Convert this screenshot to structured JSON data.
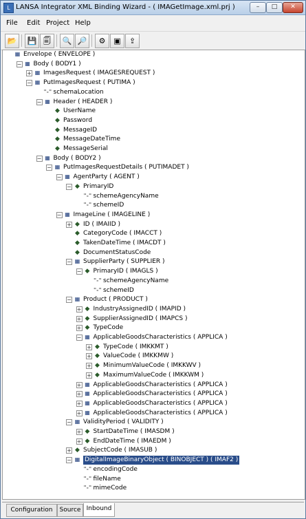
{
  "window": {
    "title": "LANSA Integrator XML Binding Wizard - ( IMAGetImage.xml.prj )"
  },
  "titlebar_buttons": {
    "minimize": "–",
    "maximize": "□",
    "close": "✕"
  },
  "menu": [
    "File",
    "Edit",
    "Project",
    "Help"
  ],
  "toolbar": [
    {
      "name": "open-button",
      "glyph": "📂"
    },
    {
      "name": "save-button",
      "glyph": "💾"
    },
    {
      "name": "save-all-button",
      "glyph": "🗐"
    },
    {
      "name": "find-button",
      "glyph": "🔍"
    },
    {
      "name": "find-next-button",
      "glyph": "🔎"
    },
    {
      "name": "link-button",
      "glyph": "⚙"
    },
    {
      "name": "generate-button",
      "glyph": "▣"
    },
    {
      "name": "export-button",
      "glyph": "⇪"
    }
  ],
  "tree": [
    {
      "lvl": 0,
      "icon": "elem",
      "tog": "",
      "label": "Envelope ( ENVELOPE )"
    },
    {
      "lvl": 1,
      "icon": "elem",
      "tog": "−",
      "label": "Body ( BODY1 )"
    },
    {
      "lvl": 2,
      "icon": "elem",
      "tog": "+",
      "label": "ImagesRequest ( IMAGESREQUEST )"
    },
    {
      "lvl": 2,
      "icon": "elem",
      "tog": "−",
      "label": "PutImagesRequest ( PUTIMA )"
    },
    {
      "lvl": 3,
      "icon": "attr",
      "tog": "",
      "label": "schemaLocation"
    },
    {
      "lvl": 3,
      "icon": "elem",
      "tog": "−",
      "label": "Header ( HEADER )"
    },
    {
      "lvl": 4,
      "icon": "field",
      "tog": "",
      "label": "UserName"
    },
    {
      "lvl": 4,
      "icon": "field",
      "tog": "",
      "label": "Password"
    },
    {
      "lvl": 4,
      "icon": "field",
      "tog": "",
      "label": "MessageID"
    },
    {
      "lvl": 4,
      "icon": "field",
      "tog": "",
      "label": "MessageDateTime"
    },
    {
      "lvl": 4,
      "icon": "field",
      "tog": "",
      "label": "MessageSerial"
    },
    {
      "lvl": 3,
      "icon": "elem",
      "tog": "−",
      "label": "Body ( BODY2 )"
    },
    {
      "lvl": 4,
      "icon": "elem",
      "tog": "−",
      "label": "PutImagesRequestDetails ( PUTIMADET )"
    },
    {
      "lvl": 5,
      "icon": "elem",
      "tog": "−",
      "label": "AgentParty ( AGENT )"
    },
    {
      "lvl": 6,
      "icon": "field",
      "tog": "−",
      "label": "PrimaryID"
    },
    {
      "lvl": 7,
      "icon": "attr",
      "tog": "",
      "label": "schemeAgencyName"
    },
    {
      "lvl": 7,
      "icon": "attr",
      "tog": "",
      "label": "schemeID"
    },
    {
      "lvl": 5,
      "icon": "elem",
      "tog": "−",
      "label": "ImageLine ( IMAGELINE )"
    },
    {
      "lvl": 6,
      "icon": "field",
      "tog": "+",
      "label": "ID ( IMAIID )"
    },
    {
      "lvl": 6,
      "icon": "field",
      "tog": "",
      "label": "CategoryCode ( IMACCT )"
    },
    {
      "lvl": 6,
      "icon": "field",
      "tog": "",
      "label": "TakenDateTime ( IMACDT )"
    },
    {
      "lvl": 6,
      "icon": "field",
      "tog": "",
      "label": "DocumentStatusCode"
    },
    {
      "lvl": 6,
      "icon": "elem",
      "tog": "−",
      "label": "SupplierParty ( SUPPLIER )"
    },
    {
      "lvl": 7,
      "icon": "field",
      "tog": "−",
      "label": "PrimaryID ( IMAGLS )"
    },
    {
      "lvl": 8,
      "icon": "attr",
      "tog": "",
      "label": "schemeAgencyName"
    },
    {
      "lvl": 8,
      "icon": "attr",
      "tog": "",
      "label": "schemeID"
    },
    {
      "lvl": 6,
      "icon": "elem",
      "tog": "−",
      "label": "Product ( PRODUCT )"
    },
    {
      "lvl": 7,
      "icon": "field",
      "tog": "+",
      "label": "IndustryAssignedID ( IMAPID )"
    },
    {
      "lvl": 7,
      "icon": "field",
      "tog": "+",
      "label": "SupplierAssignedID ( IMAPCS )"
    },
    {
      "lvl": 7,
      "icon": "field",
      "tog": "+",
      "label": "TypeCode"
    },
    {
      "lvl": 7,
      "icon": "elem",
      "tog": "−",
      "label": "ApplicableGoodsCharacteristics ( APPLICA )"
    },
    {
      "lvl": 8,
      "icon": "field",
      "tog": "+",
      "label": "TypeCode ( IMKKMT )"
    },
    {
      "lvl": 8,
      "icon": "field",
      "tog": "+",
      "label": "ValueCode ( IMKKMW )"
    },
    {
      "lvl": 8,
      "icon": "field",
      "tog": "+",
      "label": "MinimumValueCode ( IMKKWV )"
    },
    {
      "lvl": 8,
      "icon": "field",
      "tog": "+",
      "label": "MaximumValueCode ( IMKKWM )"
    },
    {
      "lvl": 7,
      "icon": "elem",
      "tog": "+",
      "label": "ApplicableGoodsCharacteristics ( APPLICA )"
    },
    {
      "lvl": 7,
      "icon": "elem",
      "tog": "+",
      "label": "ApplicableGoodsCharacteristics ( APPLICA )"
    },
    {
      "lvl": 7,
      "icon": "elem",
      "tog": "+",
      "label": "ApplicableGoodsCharacteristics ( APPLICA )"
    },
    {
      "lvl": 7,
      "icon": "elem",
      "tog": "+",
      "label": "ApplicableGoodsCharacteristics ( APPLICA )"
    },
    {
      "lvl": 6,
      "icon": "elem",
      "tog": "−",
      "label": "ValidityPeriod ( VALIDITY )"
    },
    {
      "lvl": 7,
      "icon": "field",
      "tog": "+",
      "label": "StartDateTime ( IMASDM )"
    },
    {
      "lvl": 7,
      "icon": "field",
      "tog": "+",
      "label": "EndDateTime ( IMAEDM )"
    },
    {
      "lvl": 6,
      "icon": "field",
      "tog": "+",
      "label": "SubjectCode ( IMASUB )"
    },
    {
      "lvl": 6,
      "icon": "elem",
      "tog": "−",
      "label": "DigitalImageBinaryObject ( BINOBJECT ) ( IMAF2 )",
      "selected": true
    },
    {
      "lvl": 7,
      "icon": "attr",
      "tog": "",
      "label": "encodingCode"
    },
    {
      "lvl": 7,
      "icon": "attr",
      "tog": "",
      "label": "fileName"
    },
    {
      "lvl": 7,
      "icon": "attr",
      "tog": "",
      "label": "mimeCode"
    }
  ],
  "tabs": [
    {
      "label": "Configuration",
      "active": false
    },
    {
      "label": "Source",
      "active": false
    },
    {
      "label": "Inbound",
      "active": true
    }
  ]
}
